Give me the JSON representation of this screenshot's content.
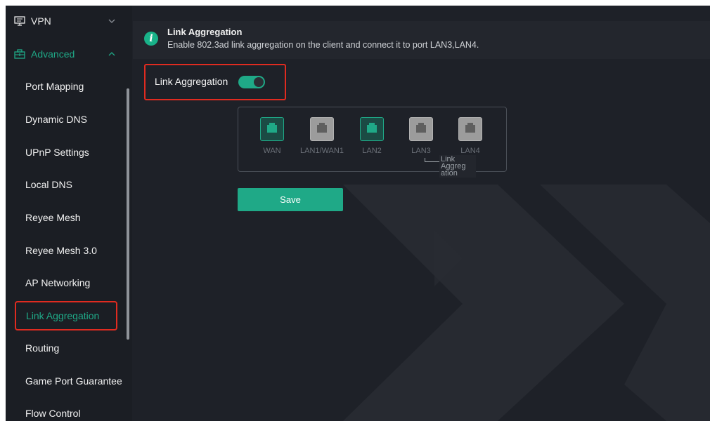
{
  "sidebar": {
    "vpn_label": "VPN",
    "advanced_label": "Advanced",
    "items": [
      {
        "label": "Port Mapping"
      },
      {
        "label": "Dynamic DNS"
      },
      {
        "label": "UPnP Settings"
      },
      {
        "label": "Local DNS"
      },
      {
        "label": "Reyee Mesh"
      },
      {
        "label": "Reyee Mesh 3.0"
      },
      {
        "label": "AP Networking"
      },
      {
        "label": "Link Aggregation"
      },
      {
        "label": "Routing"
      },
      {
        "label": "Game Port Guarantee"
      },
      {
        "label": "Flow Control"
      }
    ],
    "active_index": 7
  },
  "banner": {
    "icon": "info-icon",
    "title": "Link Aggregation",
    "description": "Enable 802.3ad link aggregation on the client and connect it to port LAN3,LAN4."
  },
  "toggle": {
    "label": "Link Aggregation",
    "enabled": true
  },
  "ports": [
    {
      "label": "WAN",
      "active": true
    },
    {
      "label": "LAN1/WAN1",
      "active": false
    },
    {
      "label": "LAN2",
      "active": true
    },
    {
      "label": "LAN3",
      "active": false
    },
    {
      "label": "LAN4",
      "active": false
    }
  ],
  "aggregation_label": "Link Aggreg ation",
  "save_label": "Save",
  "colors": {
    "accent": "#1fa987",
    "highlight_border": "#e02b20",
    "background": "#1e2128"
  }
}
